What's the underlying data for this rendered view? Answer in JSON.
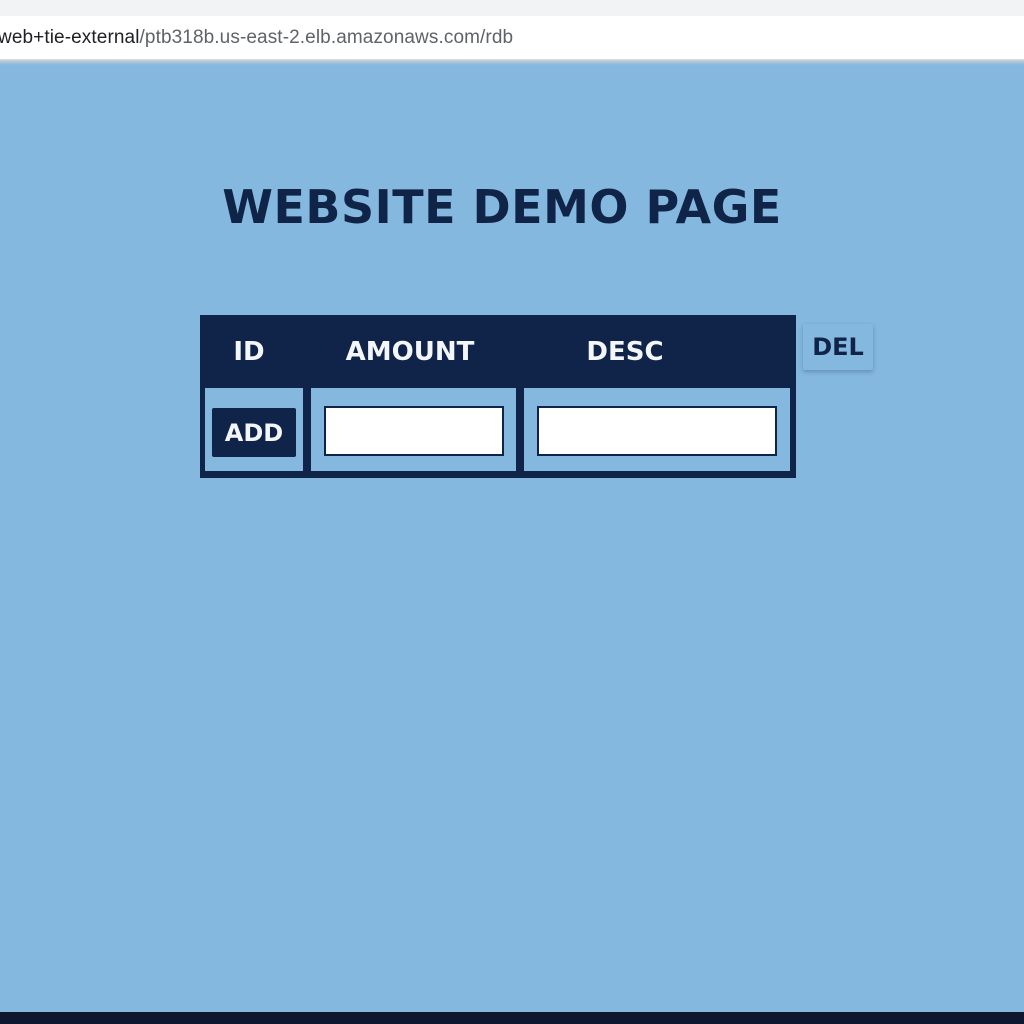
{
  "browser": {
    "url_host": "web+tie-external",
    "url_path": "/ptb318b.us-east-2.elb.amazonaws.com/rdb"
  },
  "page": {
    "title": "WEBSITE DEMO PAGE"
  },
  "table": {
    "headers": [
      "ID",
      "AMOUNT",
      "DESC"
    ],
    "add_label": "ADD",
    "amount_value": "",
    "desc_value": ""
  },
  "del_label": "DEL",
  "colors": {
    "page_background": "#84b8df",
    "navy": "#102349",
    "title_text": "#102447"
  }
}
